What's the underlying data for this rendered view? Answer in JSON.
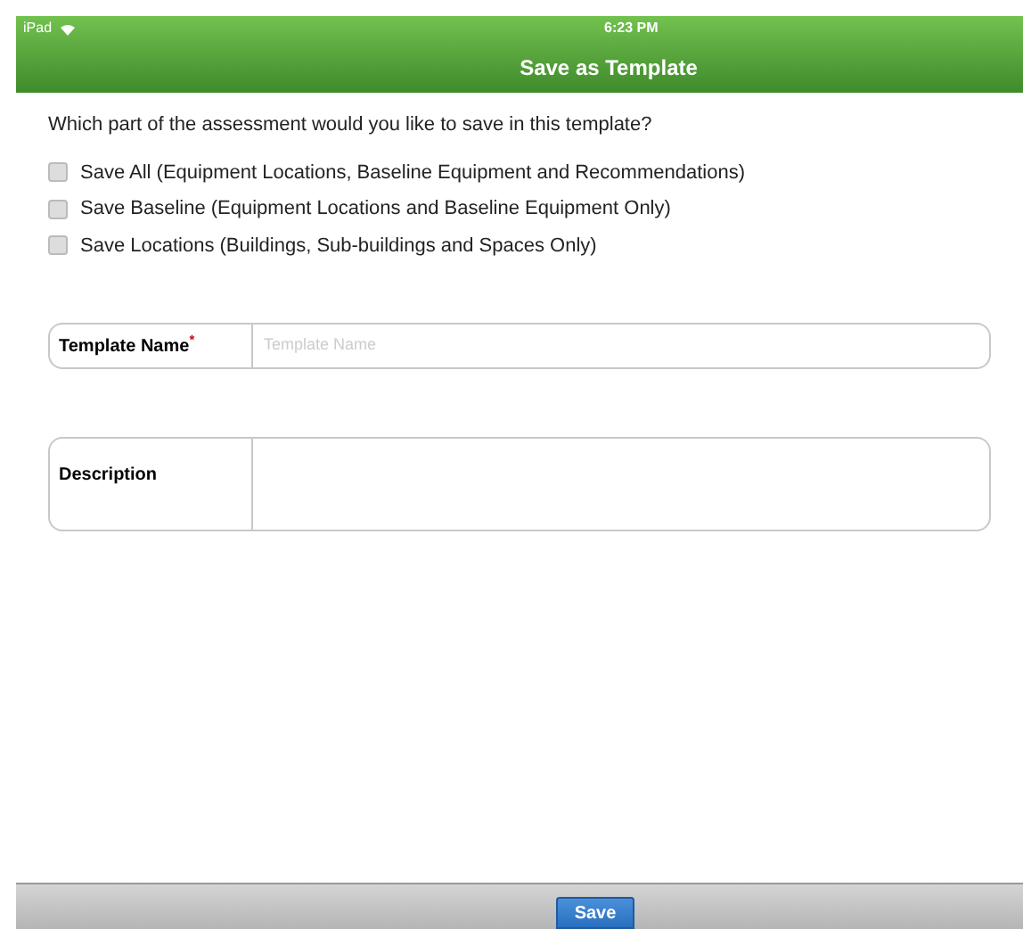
{
  "status_bar": {
    "device": "iPad",
    "time": "6:23 PM"
  },
  "window": {
    "title": "Save as Template"
  },
  "question": "Which part of the assessment would you like to save in this template?",
  "options": [
    {
      "label": "Save All (Equipment Locations, Baseline Equipment and Recommendations)",
      "checked": false
    },
    {
      "label": "Save Baseline (Equipment Locations and Baseline Equipment Only)",
      "checked": false
    },
    {
      "label": "Save Locations (Buildings, Sub-buildings and Spaces Only)",
      "checked": false
    }
  ],
  "template_name": {
    "label": "Template Name",
    "required_mark": "*",
    "placeholder": "Template Name"
  },
  "description": {
    "label": "Description"
  },
  "buttons": [
    "Save"
  ]
}
